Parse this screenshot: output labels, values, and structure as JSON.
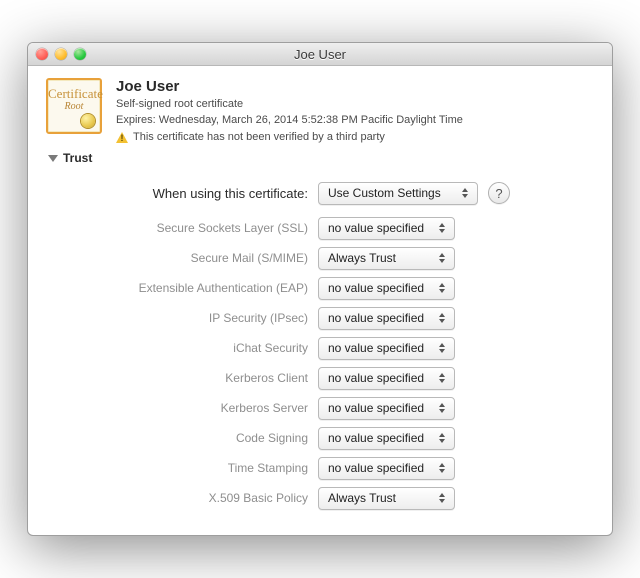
{
  "titlebar": {
    "title": "Joe User"
  },
  "header": {
    "name": "Joe User",
    "kind": "Self-signed root certificate",
    "expires": "Expires: Wednesday, March 26, 2014 5:52:38 PM Pacific Daylight Time",
    "warning": "This certificate has not been verified by a third party"
  },
  "section": {
    "title": "Trust"
  },
  "primary": {
    "label": "When using this certificate:",
    "value": "Use Custom Settings",
    "help": "?"
  },
  "rows": [
    {
      "label": "Secure Sockets Layer (SSL)",
      "value": "no value specified"
    },
    {
      "label": "Secure Mail (S/MIME)",
      "value": "Always Trust"
    },
    {
      "label": "Extensible Authentication (EAP)",
      "value": "no value specified"
    },
    {
      "label": "IP Security (IPsec)",
      "value": "no value specified"
    },
    {
      "label": "iChat Security",
      "value": "no value specified"
    },
    {
      "label": "Kerberos Client",
      "value": "no value specified"
    },
    {
      "label": "Kerberos Server",
      "value": "no value specified"
    },
    {
      "label": "Code Signing",
      "value": "no value specified"
    },
    {
      "label": "Time Stamping",
      "value": "no value specified"
    },
    {
      "label": "X.509 Basic Policy",
      "value": "Always Trust"
    }
  ],
  "icon_text": {
    "word1": "Certificate",
    "word2": "Root"
  }
}
